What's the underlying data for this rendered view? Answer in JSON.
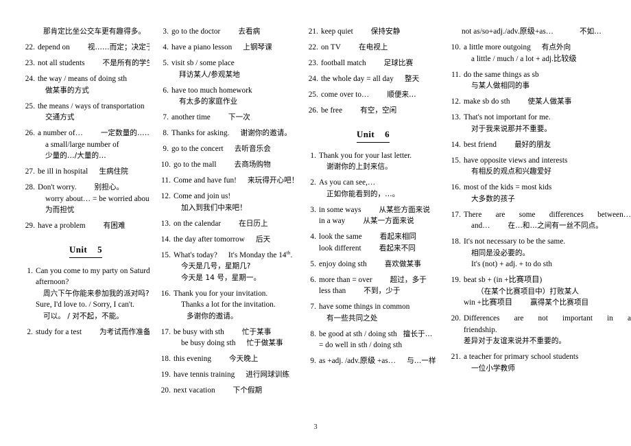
{
  "page": {
    "number": "3"
  },
  "headings": {
    "unit5": {
      "word": "Unit",
      "number": "5"
    },
    "unit6": {
      "word": "Unit",
      "number": "6"
    }
  },
  "col1": {
    "intro_cn": "那肯定比坐公交车更有趣得多。",
    "entries": [
      {
        "num": "22.",
        "lines": [
          {
            "en": "depend on",
            "cn": "视……而定；决定于",
            "indent": 0
          }
        ]
      },
      {
        "num": "23.",
        "lines": [
          {
            "en": "not all students",
            "cn": "不是所有的学生",
            "indent": 0
          }
        ]
      },
      {
        "num": "24.",
        "lines": [
          {
            "en": "the way / means of doing sth",
            "cn": "",
            "indent": 0
          },
          {
            "en": "",
            "cn": "做某事的方式",
            "indent": 1
          }
        ]
      },
      {
        "num": "25.",
        "lines": [
          {
            "en": "the means / ways of transportation",
            "cn": "",
            "indent": 0
          },
          {
            "en": "",
            "cn": "交通方式",
            "indent": 1
          }
        ]
      },
      {
        "num": "26.",
        "lines": [
          {
            "en": "a number of…",
            "cn": "一定数量的……",
            "indent": 0
          },
          {
            "en": "a small/large number of",
            "cn": "",
            "indent": 1
          },
          {
            "en": "",
            "cn": "少量的…/大量的…",
            "indent": 1
          }
        ]
      },
      {
        "num": "27.",
        "lines": [
          {
            "en": "be ill in hospital",
            "cn": "生病住院",
            "indent": 0
          }
        ]
      },
      {
        "num": "28.",
        "lines": [
          {
            "en": "Don't worry.",
            "cn": "别担心。",
            "indent": 0
          },
          {
            "en": "worry about… = be worried about…",
            "cn": "",
            "indent": 1
          },
          {
            "en": "",
            "cn": "为而担忧",
            "indent": 1
          }
        ]
      },
      {
        "num": "29.",
        "lines": [
          {
            "en": "have a problem",
            "cn": "有困难",
            "indent": 0
          }
        ]
      }
    ],
    "unit5_entries": [
      {
        "num": "1.",
        "lines": [
          {
            "en": "Can you come to my party on Saturday",
            "cn": "",
            "indent": 0
          },
          {
            "en": "afternoon?",
            "cn": "",
            "indent": 0
          },
          {
            "en": "",
            "cn": "周六下午你能来参加我的派对吗?",
            "indent": 1
          },
          {
            "en": "Sure, I'd love to. / Sorry, I can't.",
            "cn": "",
            "indent": 0
          },
          {
            "en": "",
            "cn": "可以。 / 对不起，不能。",
            "indent": 1
          }
        ]
      },
      {
        "num": "2.",
        "lines": [
          {
            "en": "study for a test",
            "cn": "为考试而作准备",
            "indent": 0
          }
        ]
      }
    ]
  },
  "col2": {
    "entries": [
      {
        "num": "3.",
        "lines": [
          {
            "en": "go to the doctor",
            "cn": "去看病",
            "indent": 0
          }
        ]
      },
      {
        "num": "4.",
        "lines": [
          {
            "en": "have a piano lesson",
            "cn": "上钢琴课",
            "indent": 0
          }
        ]
      },
      {
        "num": "5.",
        "lines": [
          {
            "en": "visit sb / some place",
            "cn": "",
            "indent": 0
          },
          {
            "en": "",
            "cn": "拜访某人/参观某地",
            "indent": 1
          }
        ]
      },
      {
        "num": "6.",
        "lines": [
          {
            "en": "have too much homework",
            "cn": "",
            "indent": 0
          },
          {
            "en": "",
            "cn": "有太多的家庭作业",
            "indent": 1
          }
        ]
      },
      {
        "num": "7.",
        "lines": [
          {
            "en": "another time",
            "cn": "下一次",
            "indent": 0
          }
        ]
      },
      {
        "num": "8.",
        "lines": [
          {
            "en": "Thanks for asking.",
            "cn": "谢谢你的邀请。",
            "indent": 0
          }
        ]
      },
      {
        "num": "9.",
        "lines": [
          {
            "en": "go to the concert",
            "cn": "去听音乐会",
            "indent": 0
          }
        ]
      },
      {
        "num": "10.",
        "lines": [
          {
            "en": "go to the mall",
            "cn": "去商场购物",
            "indent": 0
          }
        ]
      },
      {
        "num": "11.",
        "lines": [
          {
            "en": "Come and have fun!",
            "cn": "来玩得开心吧！",
            "indent": 0
          }
        ]
      },
      {
        "num": "12.",
        "lines": [
          {
            "en": "Come and join us!",
            "cn": "",
            "indent": 0
          },
          {
            "en": "",
            "cn": "加入到我们中来吧！",
            "indent": 1
          }
        ]
      },
      {
        "num": "13.",
        "lines": [
          {
            "en": "on the calendar",
            "cn": "在日历上",
            "indent": 0
          }
        ]
      },
      {
        "num": "14.",
        "lines": [
          {
            "en": "the day after tomorrow",
            "cn": "后天",
            "indent": 0
          }
        ]
      },
      {
        "num": "15.",
        "lines": [
          {
            "en": "What's today?",
            "en2": "It's Monday the 14",
            "sup": "th",
            "en3": ".",
            "cn": "",
            "indent": 0,
            "special": "date"
          },
          {
            "en": "",
            "cn": "今天是几号，星期几?",
            "indent": 1
          },
          {
            "en": "",
            "cn": "今天是 14 号，星期一。",
            "indent": 1
          }
        ]
      },
      {
        "num": "16.",
        "lines": [
          {
            "en": "Thank you for your invitation.",
            "cn": "",
            "indent": 0
          },
          {
            "en": "Thanks a lot for the invitation.",
            "cn": "",
            "indent": 1
          },
          {
            "en": "",
            "cn": "多谢你的邀请。",
            "indent": 2
          }
        ]
      },
      {
        "num": "17.",
        "lines": [
          {
            "en": "be busy with sth",
            "cn": "忙于某事",
            "indent": 0
          },
          {
            "en": "be busy doing sth",
            "cn": "忙于做某事",
            "indent": 1
          }
        ]
      },
      {
        "num": "18.",
        "lines": [
          {
            "en": "this evening",
            "cn": "今天晚上",
            "indent": 0
          }
        ]
      },
      {
        "num": "19.",
        "lines": [
          {
            "en": "have tennis training",
            "cn": "进行网球训练",
            "indent": 0
          }
        ]
      },
      {
        "num": "20.",
        "lines": [
          {
            "en": "next vacation",
            "cn": "下个假期",
            "indent": 0
          }
        ]
      }
    ]
  },
  "col3": {
    "entries": [
      {
        "num": "21.",
        "lines": [
          {
            "en": "keep quiet",
            "cn": "保持安静",
            "indent": 0
          }
        ]
      },
      {
        "num": "22.",
        "lines": [
          {
            "en": "on TV",
            "cn": "在电视上",
            "indent": 0
          }
        ]
      },
      {
        "num": "23.",
        "lines": [
          {
            "en": "football match",
            "cn": "足球比赛",
            "indent": 0
          }
        ]
      },
      {
        "num": "24.",
        "lines": [
          {
            "en": "the whole day = all day",
            "cn": "整天",
            "indent": 0
          }
        ]
      },
      {
        "num": "25.",
        "lines": [
          {
            "en": "come over to…",
            "cn": "顺便来…",
            "indent": 0
          }
        ]
      },
      {
        "num": "26.",
        "lines": [
          {
            "en": "be free",
            "cn": "有空，空闲",
            "indent": 0
          }
        ]
      }
    ],
    "unit6_entries": [
      {
        "num": "1.",
        "lines": [
          {
            "en": "Thank you for your last letter.",
            "cn": "",
            "indent": 0
          },
          {
            "en": "",
            "cn": "谢谢你的上封来信。",
            "indent": 1
          }
        ]
      },
      {
        "num": "2.",
        "lines": [
          {
            "en": "As you can see,…",
            "cn": "",
            "indent": 0
          },
          {
            "en": "",
            "cn": "正如你能看到的，…。",
            "indent": 1
          }
        ]
      },
      {
        "num": "3.",
        "lines": [
          {
            "en": "in some ways",
            "cn": "从某些方面来说",
            "indent": 0
          },
          {
            "en": "in a way",
            "cn": "从某一方面来说",
            "indent": 0
          }
        ]
      },
      {
        "num": "4.",
        "lines": [
          {
            "en": "look the same",
            "cn": "看起来相同",
            "indent": 0
          },
          {
            "en": "look different",
            "cn": "看起来不同",
            "indent": 0
          }
        ]
      },
      {
        "num": "5.",
        "lines": [
          {
            "en": "enjoy doing sth",
            "cn": "喜欢做某事",
            "indent": 0
          }
        ]
      },
      {
        "num": "6.",
        "lines": [
          {
            "en": "more than = over",
            "cn": "超过，多于",
            "indent": 0
          },
          {
            "en": "less than",
            "cn": "不到，少于",
            "indent": 0
          }
        ]
      },
      {
        "num": "7.",
        "lines": [
          {
            "en": "have some things in common",
            "cn": "",
            "indent": 0
          },
          {
            "en": "",
            "cn": "有一些共同之处",
            "indent": 1
          }
        ]
      },
      {
        "num": "8.",
        "lines": [
          {
            "en": "be good at sth / doing sth",
            "cn": "擅长于…",
            "indent": 0
          },
          {
            "en": "= do well in sth / doing sth",
            "cn": "",
            "indent": 0
          }
        ]
      },
      {
        "num": "9.",
        "lines": [
          {
            "en": "as +adj. /adv.原级 +as…",
            "cn": "与…一样",
            "indent": 0
          }
        ]
      }
    ]
  },
  "col4": {
    "intro": "not as/so+adj./adv.原级+as…",
    "intro_cn": "不如…",
    "entries": [
      {
        "num": "10.",
        "lines": [
          {
            "en": "a little more outgoing",
            "cn": "有点外向",
            "indent": 0
          },
          {
            "en": "a little / much / a lot + adj.比较级",
            "cn": "",
            "indent": 1
          }
        ]
      },
      {
        "num": "11.",
        "lines": [
          {
            "en": "do the same things as sb",
            "cn": "",
            "indent": 0
          },
          {
            "en": "",
            "cn": "与某人做相同的事",
            "indent": 1
          }
        ]
      },
      {
        "num": "12.",
        "lines": [
          {
            "en": "make sb do sth",
            "cn": "使某人做某事",
            "indent": 0
          }
        ]
      },
      {
        "num": "13.",
        "lines": [
          {
            "en": "That's not important for me.",
            "cn": "",
            "indent": 0
          },
          {
            "en": "",
            "cn": "对于我来说那并不重要。",
            "indent": 1
          }
        ]
      },
      {
        "num": "14.",
        "lines": [
          {
            "en": "best friend",
            "cn": "最好的朋友",
            "indent": 0
          }
        ]
      },
      {
        "num": "15.",
        "lines": [
          {
            "en": "have opposite views and interests",
            "cn": "",
            "indent": 0
          },
          {
            "en": "",
            "cn": "有相反的观点和兴趣爱好",
            "indent": 1
          }
        ]
      },
      {
        "num": "16.",
        "lines": [
          {
            "en": "most of the kids = most kids",
            "cn": "",
            "indent": 0
          },
          {
            "en": "",
            "cn": "大多数的孩子",
            "indent": 1
          }
        ]
      },
      {
        "num": "17.",
        "lines": [
          {
            "en": "There are some differences between…",
            "cn": "",
            "indent": 0,
            "justify": true
          },
          {
            "en": "and…",
            "cn": "在…和…之间有一丝不同点。",
            "indent": 1
          }
        ]
      },
      {
        "num": "18.",
        "lines": [
          {
            "en": "It's not necessary to be the same.",
            "cn": "",
            "indent": 0
          },
          {
            "en": "",
            "cn": "相同是没必要的。",
            "indent": 1
          },
          {
            "en": "It's (not) + adj. + to do sth",
            "cn": "",
            "indent": 1
          }
        ]
      },
      {
        "num": "19.",
        "lines": [
          {
            "en": "beat sb + (in +比赛项目)",
            "cn": "",
            "indent": 0
          },
          {
            "en": "",
            "cn": "（在某个比赛项目中）打败某人",
            "indent": 2
          },
          {
            "en": "win +比赛项目",
            "cn": "赢得某个比赛项目",
            "indent": 0
          }
        ]
      },
      {
        "num": "20.",
        "lines": [
          {
            "en": "Differences are not important in a",
            "cn": "",
            "indent": 0,
            "justify": true
          },
          {
            "en": "friendship.",
            "cn": "",
            "indent": 0
          },
          {
            "en": "",
            "cn": "差异对于友谊来说并不重要的。",
            "indent": 0
          }
        ]
      },
      {
        "num": "21.",
        "lines": [
          {
            "en": "a teacher for primary school students",
            "cn": "",
            "indent": 0
          },
          {
            "en": "",
            "cn": "一位小学教师",
            "indent": 1
          }
        ]
      }
    ]
  }
}
